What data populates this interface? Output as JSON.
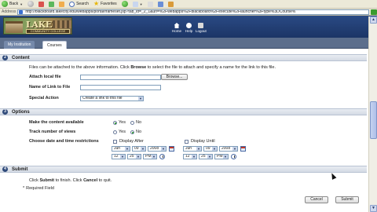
{
  "browser": {
    "back_label": "Back",
    "search_label": "Search",
    "favorites_label": "Favorites",
    "address_label": "Address",
    "url": "http://blackboard.lakecity.edu/webapps/portal/frameset.jsp?tab_id=_2_1&url=%2Fwebapps%2Fblackboard%2Fexecute%2Flauncher%3Ftype%3DCourse%"
  },
  "header": {
    "logo_title": "LAKE CITY",
    "logo_subtitle": "COMMUNITY COLLEGE",
    "home_label": "Home",
    "help_label": "Help",
    "logout_label": "Logout"
  },
  "tabs": [
    "My Institution",
    "Courses"
  ],
  "content_section": {
    "number": "2",
    "title": "Content",
    "description_pre": "Files can be attached to the above information. Click ",
    "description_bold": "Browse",
    "description_post": " to select the file to attach and specify a name for the link to this file.",
    "attach_label": "Attach local file",
    "browse_label": "Browse...",
    "link_name_label": "Name of Link to File",
    "special_action_label": "Special Action",
    "special_action_value": "Create a link to this file"
  },
  "options_section": {
    "number": "3",
    "title": "Options",
    "make_available_label": "Make the content available",
    "track_views_label": "Track number of views",
    "yes_label": "Yes",
    "no_label": "No",
    "make_available_selected": "Yes",
    "track_views_selected": "No",
    "date_restrictions_label": "Choose date and time restrictions",
    "display_after_label": "Display After",
    "display_until_label": "Display Until",
    "after_month": "Jun",
    "after_day": "09",
    "after_year": "2008",
    "after_hour": "12",
    "after_minute": "25",
    "after_ampm": "PM",
    "until_month": "Jun",
    "until_day": "09",
    "until_year": "2008",
    "until_hour": "12",
    "until_minute": "25",
    "until_ampm": "PM"
  },
  "submit_section": {
    "number": "4",
    "title": "Submit",
    "instruction_pre": "Click ",
    "instruction_submit": "Submit",
    "instruction_mid": " to finish. Click ",
    "instruction_cancel": "Cancel",
    "instruction_post": " to quit.",
    "required_mark": "*",
    "required_label": "Required Field",
    "cancel_label": "Cancel",
    "submit_label": "Submit"
  },
  "colors": {
    "banner": "#1c3566",
    "tab_bar": "#5c6e8c",
    "section_bg": "#d4dae4"
  }
}
